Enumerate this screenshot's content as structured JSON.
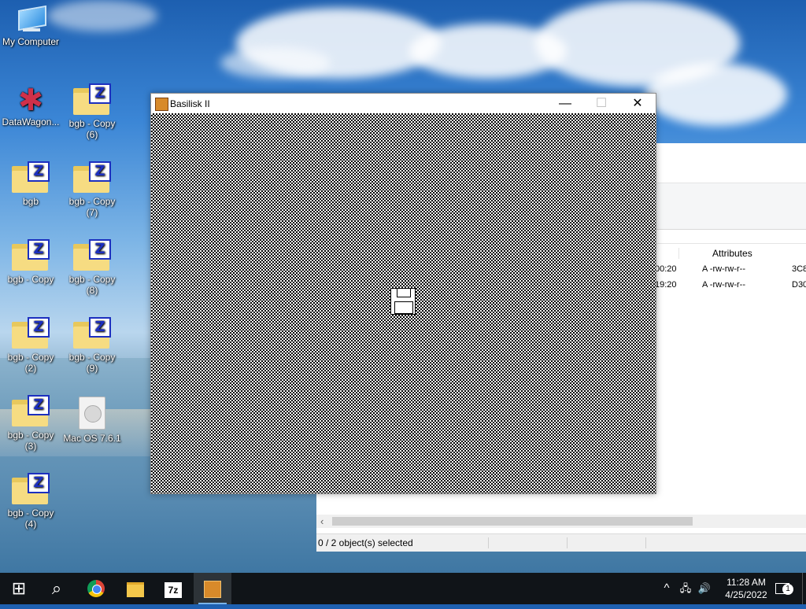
{
  "desktop": {
    "icons": [
      {
        "label": "My Computer"
      },
      {
        "label": "DataWagon..."
      },
      {
        "label": "bgb - Copy (6)"
      },
      {
        "label": "bgb"
      },
      {
        "label": "bgb - Copy (7)"
      },
      {
        "label": "bgb - Copy"
      },
      {
        "label": "bgb - Copy (8)"
      },
      {
        "label": "bgb - Copy (2)"
      },
      {
        "label": "bgb - Copy (9)"
      },
      {
        "label": "bgb - Copy (3)"
      },
      {
        "label": "Mac OS 7.6.1"
      },
      {
        "label": "bgb - Copy (4)"
      }
    ]
  },
  "explorer": {
    "column_header": "Attributes",
    "rows": [
      {
        "time_fragment": "00:20",
        "attributes": "A -rw-rw-r--",
        "crc": "3C8"
      },
      {
        "time_fragment": "19:20",
        "attributes": "A -rw-rw-r--",
        "crc": "D30"
      }
    ],
    "status": "0 / 2 object(s) selected",
    "scroll_left_glyph": "‹"
  },
  "basilisk": {
    "title": "Basilisk II",
    "minimize_glyph": "—",
    "maximize_glyph": "☐",
    "close_glyph": "✕"
  },
  "taskbar": {
    "start_glyph": "⊞",
    "search_glyph": "⌕",
    "apps": [
      {
        "name": "Google Chrome",
        "icon": "chrome-icon"
      },
      {
        "name": "File Explorer",
        "icon": "folder-icon"
      },
      {
        "name": "7-Zip",
        "label": "7z"
      },
      {
        "name": "Basilisk II",
        "icon": "basilisk-icon"
      }
    ],
    "tray": {
      "chevron": "^",
      "network": "🖧",
      "volume": "🔊"
    },
    "time": "11:28 AM",
    "date": "4/25/2022",
    "notification_count": "1"
  }
}
